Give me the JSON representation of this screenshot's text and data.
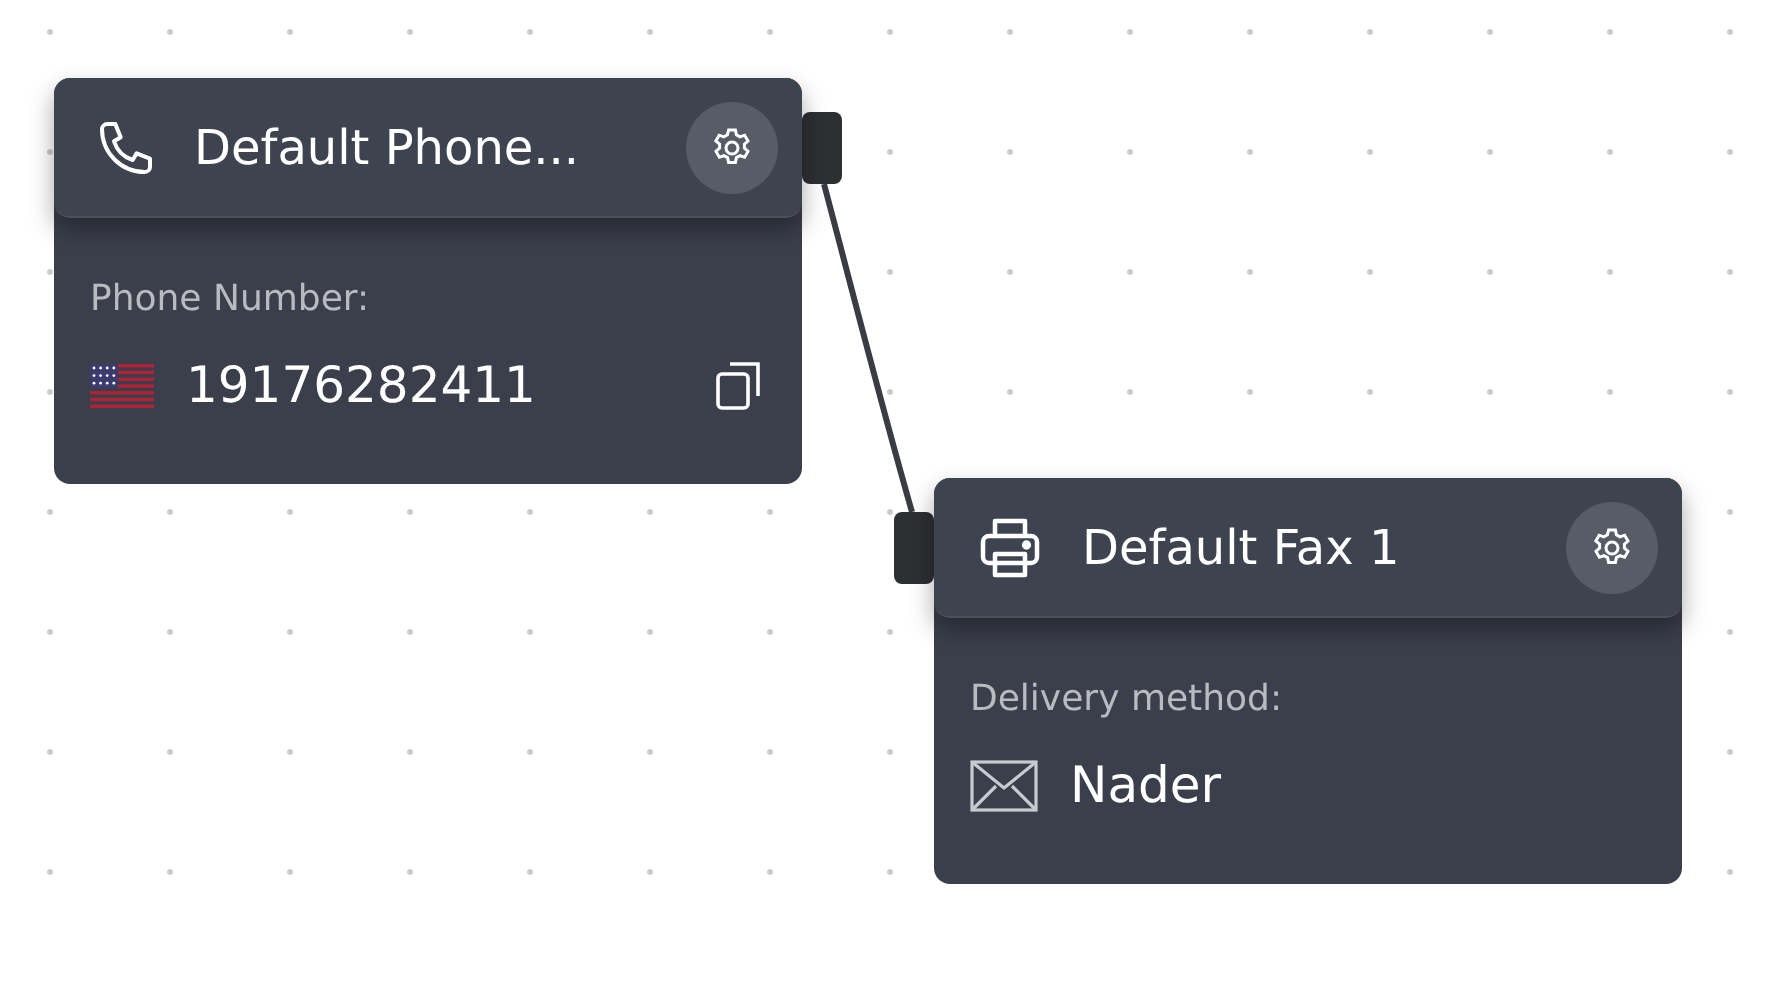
{
  "nodes": [
    {
      "kind": "phone",
      "title": "Default Phone...",
      "field_label": "Phone Number:",
      "value": {
        "kind": "flag",
        "text": "19176282411"
      },
      "copyable": true,
      "handles": [
        {
          "kind": "right"
        }
      ]
    },
    {
      "kind": "fax",
      "title": "Default Fax 1",
      "field_label": "Delivery method:",
      "value": {
        "kind": "mail",
        "text": "Nader"
      },
      "copyable": false,
      "handles": [
        {
          "kind": "left"
        }
      ]
    }
  ]
}
